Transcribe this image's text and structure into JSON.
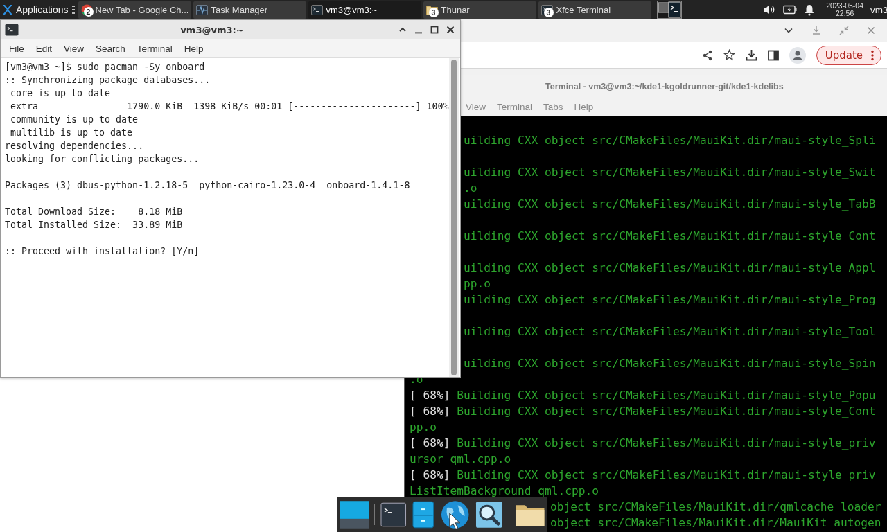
{
  "taskbar": {
    "menu_label": "Applications",
    "tasks": [
      {
        "kind": "browser",
        "label": "New Tab - Google Ch...",
        "count": "2",
        "selected": false
      },
      {
        "kind": "monitor",
        "label": "Task Manager",
        "selected": false
      },
      {
        "kind": "terminal",
        "label": "vm3@vm3:~",
        "selected": true
      },
      {
        "kind": "folder",
        "label": "Thunar",
        "count": "3",
        "selected": false
      },
      {
        "kind": "terminal",
        "label": "Xfce Terminal",
        "count": "3",
        "selected": false
      }
    ],
    "clock": {
      "date": "2023-05-04",
      "time": "22:56"
    },
    "user": "vm3"
  },
  "browser_window": {
    "update_button": "Update"
  },
  "build_terminal": {
    "title": "Terminal - vm3@vm3:~/kde1-kgoldrunner-git/kde1-kdelibs",
    "menu": [
      "View",
      "Terminal",
      "Tabs",
      "Help"
    ],
    "partly_covered_output": [
      [
        "uilding CXX object src/CMakeFiles/MauiKit.dir/maui-style_Spli"
      ],
      [
        "uilding CXX object src/CMakeFiles/MauiKit.dir/maui-style_Swit",
        ".o",
        "uilding CXX object src/CMakeFiles/MauiKit.dir/maui-style_TabB"
      ],
      [
        "uilding CXX object src/CMakeFiles/MauiKit.dir/maui-style_Cont"
      ],
      [
        "uilding CXX object src/CMakeFiles/MauiKit.dir/maui-style_Appl",
        "pp.o",
        "uilding CXX object src/CMakeFiles/MauiKit.dir/maui-style_Prog"
      ],
      [
        "uilding CXX object src/CMakeFiles/MauiKit.dir/maui-style_Tool"
      ],
      [
        "uilding CXX object src/CMakeFiles/MauiKit.dir/maui-style_Spin"
      ]
    ],
    "output": [
      {
        "text": ".o"
      },
      {
        "progress": "[ 68%]",
        "text": "Building CXX object src/CMakeFiles/MauiKit.dir/maui-style_Popu"
      },
      {
        "progress": "[ 68%]",
        "text": "Building CXX object src/CMakeFiles/MauiKit.dir/maui-style_Cont"
      },
      {
        "text": "pp.o"
      },
      {
        "progress": "[ 68%]",
        "text": "Building CXX object src/CMakeFiles/MauiKit.dir/maui-style_priv"
      },
      {
        "text": "ursor_qml.cpp.o"
      },
      {
        "progress": "[ 68%]",
        "text": "Building CXX object src/CMakeFiles/MauiKit.dir/maui-style_priv"
      },
      {
        "text": "ListItemBackground_qml.cpp.o"
      }
    ],
    "output_beside_dock": [
      "object src/CMakeFiles/MauiKit.dir/qmlcache_loader",
      "object src/CMakeFiles/MauiKit.dir/MauiKit_autogen"
    ]
  },
  "pacman_terminal": {
    "title": "vm3@vm3:~",
    "menu": [
      "File",
      "Edit",
      "View",
      "Search",
      "Terminal",
      "Help"
    ],
    "output": [
      [
        "[vm3@vm3 ~]$ sudo pacman -Sy onboard",
        ":: Synchronizing package databases...",
        " core is up to date",
        " extra                1790.0 KiB  1398 KiB/s 00:01 [----------------------] 100%",
        " community is up to date",
        " multilib is up to date",
        "resolving dependencies...",
        "looking for conflicting packages..."
      ],
      [
        "Packages (3) dbus-python-1.2.18-5  python-cairo-1.23.0-4  onboard-1.4.1-8"
      ],
      [
        "Total Download Size:    8.18 MiB",
        "Total Installed Size:  33.89 MiB"
      ],
      [
        ":: Proceed with installation? [Y/n]"
      ]
    ]
  }
}
